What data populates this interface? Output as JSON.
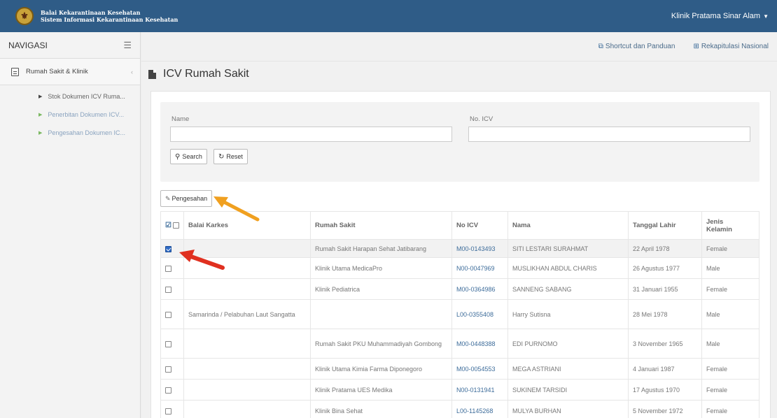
{
  "header": {
    "org_line1": "Balai Kekarantinaan Kesehatan",
    "org_line2": "Sistem Informasi Kekarantinaan Kesehatan",
    "user_menu": "Klinik Pratama Sinar Alam",
    "logo_icon": "emblem-icon"
  },
  "sidebar": {
    "title": "NAVIGASI",
    "group": {
      "label": "Rumah Sakit & Klinik"
    },
    "items": [
      {
        "label": "Stok Dokumen ICV Ruma..."
      },
      {
        "label": "Penerbitan Dokumen ICV..."
      },
      {
        "label": "Pengesahan Dokumen IC..."
      }
    ]
  },
  "topstrip": {
    "shortcut": "Shortcut dan Panduan",
    "rekap": "Rekapitulasi Nasional"
  },
  "page": {
    "title": "ICV Rumah Sakit"
  },
  "filter": {
    "name_label": "Name",
    "name_value": "",
    "icv_label": "No. ICV",
    "icv_value": "",
    "search_label": "Search",
    "reset_label": "Reset"
  },
  "actions": {
    "approve_label": "Pengesahan"
  },
  "table": {
    "headers": {
      "balai": "Balai Karkes",
      "rs": "Rumah Sakit",
      "icv": "No ICV",
      "nama": "Nama",
      "tgl": "Tanggal Lahir",
      "jk1": "Jenis",
      "jk2": "Kelamin"
    },
    "rows": [
      {
        "checked": true,
        "balai": "",
        "rs": "Rumah Sakit Harapan Sehat Jatibarang",
        "icv": "M00-0143493",
        "nama": "SITI LESTARI SURAHMAT",
        "tgl": "22 April 1978",
        "jk": "Female"
      },
      {
        "checked": false,
        "balai": "",
        "rs": "Klinik Utama MedicaPro",
        "icv": "N00-0047969",
        "nama": "MUSLIKHAN ABDUL CHARIS",
        "tgl": "26 Agustus 1977",
        "jk": "Male"
      },
      {
        "checked": false,
        "balai": "",
        "rs": "Klinik Pediatrica",
        "icv": "M00-0364986",
        "nama": "SANNENG SABANG",
        "tgl": "31 Januari 1955",
        "jk": "Female"
      },
      {
        "checked": false,
        "balai": "Samarinda / Pelabuhan Laut Sangatta",
        "rs": "",
        "icv": "L00-0355408",
        "nama": "Harry Sutisna",
        "tgl": "28 Mei 1978",
        "jk": "Male"
      },
      {
        "checked": false,
        "balai": "",
        "rs": "Rumah Sakit PKU Muhammadiyah Gombong",
        "icv": "M00-0448388",
        "nama": "EDI PURNOMO",
        "tgl": "3 November 1965",
        "jk": "Male"
      },
      {
        "checked": false,
        "balai": "",
        "rs": "Klinik Utama Kimia Farma Diponegoro",
        "icv": "M00-0054553",
        "nama": "MEGA ASTRIANI",
        "tgl": "4 Januari 1987",
        "jk": "Female"
      },
      {
        "checked": false,
        "balai": "",
        "rs": "Klinik Pratama UES Medika",
        "icv": "N00-0131941",
        "nama": "SUKINEM TARSIDI",
        "tgl": "17 Agustus 1970",
        "jk": "Female"
      },
      {
        "checked": false,
        "balai": "",
        "rs": "Klinik Bina Sehat",
        "icv": "L00-1145268",
        "nama": "MULYA BURHAN",
        "tgl": "5 November 1972",
        "jk": "Female"
      }
    ]
  },
  "annotations": {
    "orange_arrow_color": "#f0a020",
    "red_arrow_color": "#e03020"
  }
}
